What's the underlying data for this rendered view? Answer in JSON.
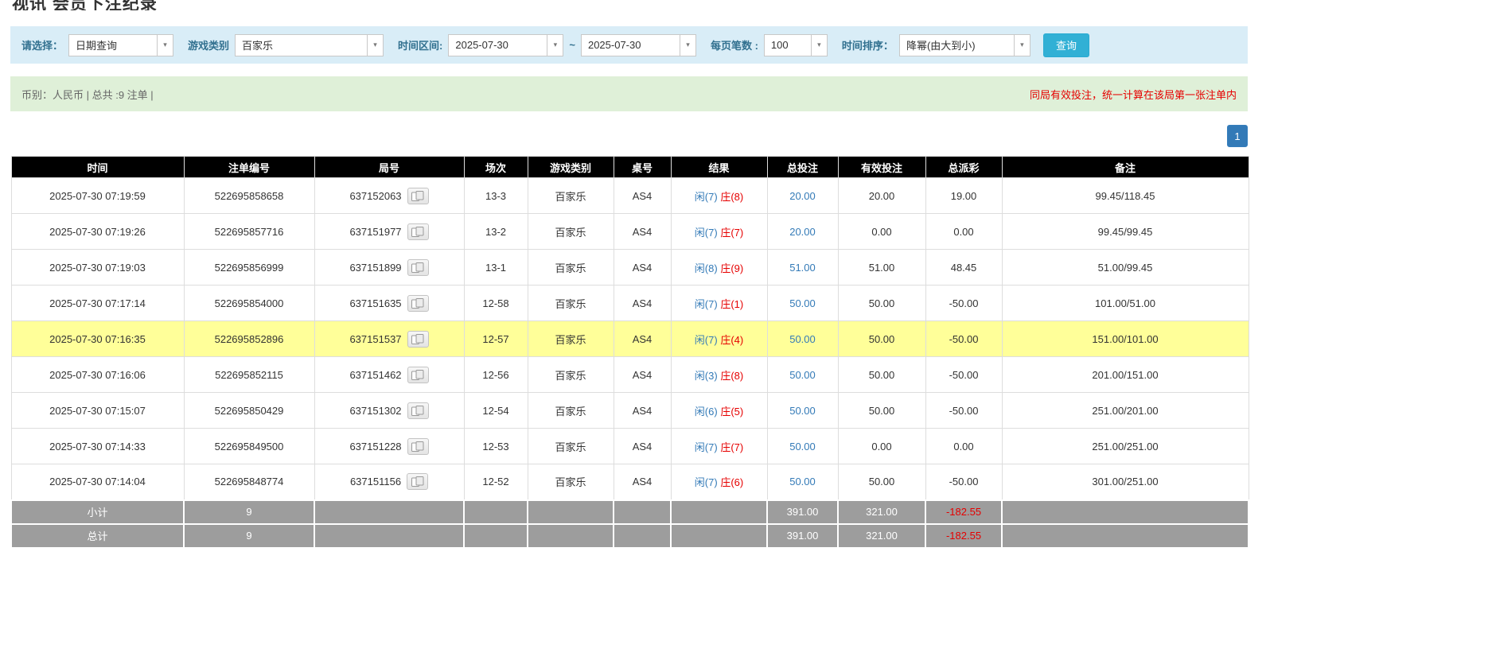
{
  "page": {
    "title": "视讯 会员下注纪录"
  },
  "icons": {
    "combo_caret": "▾",
    "round_icon": "cards-icon"
  },
  "filters": {
    "select_label": "请选择：",
    "select_value": "日期查询",
    "game_type_label": "游戏类别",
    "game_type_value": "百家乐",
    "time_range_label": "时间区间:",
    "date_from": "2025-07-30",
    "tilde": "~",
    "date_to": "2025-07-30",
    "page_size_label": "每页笔数 :",
    "page_size_value": "100",
    "time_sort_label": "时间排序：",
    "time_sort_value": "降幂(由大到小)",
    "query_button": "查询"
  },
  "summary": {
    "left": "币别：人民币 | 总共 :9 注单 |",
    "right": "同局有效投注，统一计算在该局第一张注单内"
  },
  "pagination": {
    "current": "1"
  },
  "table": {
    "headers": [
      "时间",
      "注单编号",
      "局号",
      "场次",
      "游戏类别",
      "桌号",
      "结果",
      "总投注",
      "有效投注",
      "总派彩",
      "备注"
    ],
    "rows": [
      {
        "time": "2025-07-30 07:19:59",
        "bet_id": "522695858658",
        "round_id": "637152063",
        "session": "13-3",
        "game": "百家乐",
        "table": "AS4",
        "result_player": "闲(7)",
        "result_banker": "庄(8)",
        "total_bet": "20.00",
        "valid_bet": "20.00",
        "payout": "19.00",
        "note": "99.45/118.45",
        "highlighted": false
      },
      {
        "time": "2025-07-30 07:19:26",
        "bet_id": "522695857716",
        "round_id": "637151977",
        "session": "13-2",
        "game": "百家乐",
        "table": "AS4",
        "result_player": "闲(7)",
        "result_banker": "庄(7)",
        "total_bet": "20.00",
        "valid_bet": "0.00",
        "payout": "0.00",
        "note": "99.45/99.45",
        "highlighted": false
      },
      {
        "time": "2025-07-30 07:19:03",
        "bet_id": "522695856999",
        "round_id": "637151899",
        "session": "13-1",
        "game": "百家乐",
        "table": "AS4",
        "result_player": "闲(8)",
        "result_banker": "庄(9)",
        "total_bet": "51.00",
        "valid_bet": "51.00",
        "payout": "48.45",
        "note": "51.00/99.45",
        "highlighted": false
      },
      {
        "time": "2025-07-30 07:17:14",
        "bet_id": "522695854000",
        "round_id": "637151635",
        "session": "12-58",
        "game": "百家乐",
        "table": "AS4",
        "result_player": "闲(7)",
        "result_banker": "庄(1)",
        "total_bet": "50.00",
        "valid_bet": "50.00",
        "payout": "-50.00",
        "note": "101.00/51.00",
        "highlighted": false
      },
      {
        "time": "2025-07-30 07:16:35",
        "bet_id": "522695852896",
        "round_id": "637151537",
        "session": "12-57",
        "game": "百家乐",
        "table": "AS4",
        "result_player": "闲(7)",
        "result_banker": "庄(4)",
        "total_bet": "50.00",
        "valid_bet": "50.00",
        "payout": "-50.00",
        "note": "151.00/101.00",
        "highlighted": true
      },
      {
        "time": "2025-07-30 07:16:06",
        "bet_id": "522695852115",
        "round_id": "637151462",
        "session": "12-56",
        "game": "百家乐",
        "table": "AS4",
        "result_player": "闲(3)",
        "result_banker": "庄(8)",
        "total_bet": "50.00",
        "valid_bet": "50.00",
        "payout": "-50.00",
        "note": "201.00/151.00",
        "highlighted": false
      },
      {
        "time": "2025-07-30 07:15:07",
        "bet_id": "522695850429",
        "round_id": "637151302",
        "session": "12-54",
        "game": "百家乐",
        "table": "AS4",
        "result_player": "闲(6)",
        "result_banker": "庄(5)",
        "total_bet": "50.00",
        "valid_bet": "50.00",
        "payout": "-50.00",
        "note": "251.00/201.00",
        "highlighted": false
      },
      {
        "time": "2025-07-30 07:14:33",
        "bet_id": "522695849500",
        "round_id": "637151228",
        "session": "12-53",
        "game": "百家乐",
        "table": "AS4",
        "result_player": "闲(7)",
        "result_banker": "庄(7)",
        "total_bet": "50.00",
        "valid_bet": "0.00",
        "payout": "0.00",
        "note": "251.00/251.00",
        "highlighted": false
      },
      {
        "time": "2025-07-30 07:14:04",
        "bet_id": "522695848774",
        "round_id": "637151156",
        "session": "12-52",
        "game": "百家乐",
        "table": "AS4",
        "result_player": "闲(7)",
        "result_banker": "庄(6)",
        "total_bet": "50.00",
        "valid_bet": "50.00",
        "payout": "-50.00",
        "note": "301.00/251.00",
        "highlighted": false
      }
    ],
    "subtotal": {
      "label": "小计",
      "count": "9",
      "total_bet": "391.00",
      "valid_bet": "321.00",
      "payout": "-182.55"
    },
    "total": {
      "label": "总计",
      "count": "9",
      "total_bet": "391.00",
      "valid_bet": "321.00",
      "payout": "-182.55"
    }
  },
  "colors": {
    "accent_blue": "#337ab7",
    "negative_red": "#e60000",
    "highlight_yellow": "#ffff99",
    "filter_bg": "#d9edf7",
    "summary_bg": "#dff0d8",
    "header_bg": "#000000",
    "footer_bg": "#9d9d9d",
    "query_button_bg": "#31b0d5"
  }
}
